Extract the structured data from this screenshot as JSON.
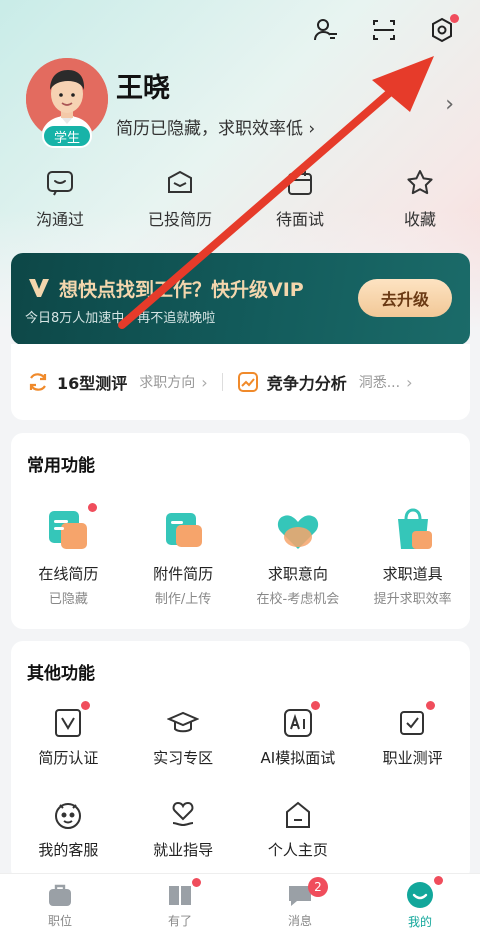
{
  "profile": {
    "name": "王晓",
    "badge": "学生",
    "status": "简历已隐藏，求职效率低 ›"
  },
  "header": {
    "icons": [
      "contacts-icon",
      "scan-icon",
      "settings-icon"
    ]
  },
  "quick_actions": [
    {
      "label": "沟通过",
      "icon": "chat-icon"
    },
    {
      "label": "已投简历",
      "icon": "sent-icon"
    },
    {
      "label": "待面试",
      "icon": "calendar-icon"
    },
    {
      "label": "收藏",
      "icon": "star-icon"
    }
  ],
  "vip": {
    "title": "想快点找到工作？快升级VIP",
    "subtitle": "今日8万人加速中，再不追就晚啦",
    "button": "去升级"
  },
  "assessment": {
    "left_title": "16型测评",
    "left_sub": "求职方向",
    "right_title": "竞争力分析",
    "right_sub": "洞悉..."
  },
  "common": {
    "title": "常用功能",
    "items": [
      {
        "label": "在线简历",
        "sub": "已隐藏"
      },
      {
        "label": "附件简历",
        "sub": "制作/上传"
      },
      {
        "label": "求职意向",
        "sub": "在校-考虑机会"
      },
      {
        "label": "求职道具",
        "sub": "提升求职效率"
      }
    ]
  },
  "other": {
    "title": "其他功能",
    "items": [
      {
        "label": "简历认证"
      },
      {
        "label": "实习专区"
      },
      {
        "label": "AI模拟面试"
      },
      {
        "label": "职业测评"
      },
      {
        "label": "我的客服"
      },
      {
        "label": "就业指导"
      },
      {
        "label": "个人主页"
      }
    ]
  },
  "tabs": [
    {
      "label": "职位"
    },
    {
      "label": "有了"
    },
    {
      "label": "消息",
      "badge": "2"
    },
    {
      "label": "我的"
    }
  ],
  "colors": {
    "accent": "#12a79b",
    "badge_red": "#f04d5c",
    "annotation_arrow": "#e63b2a"
  }
}
